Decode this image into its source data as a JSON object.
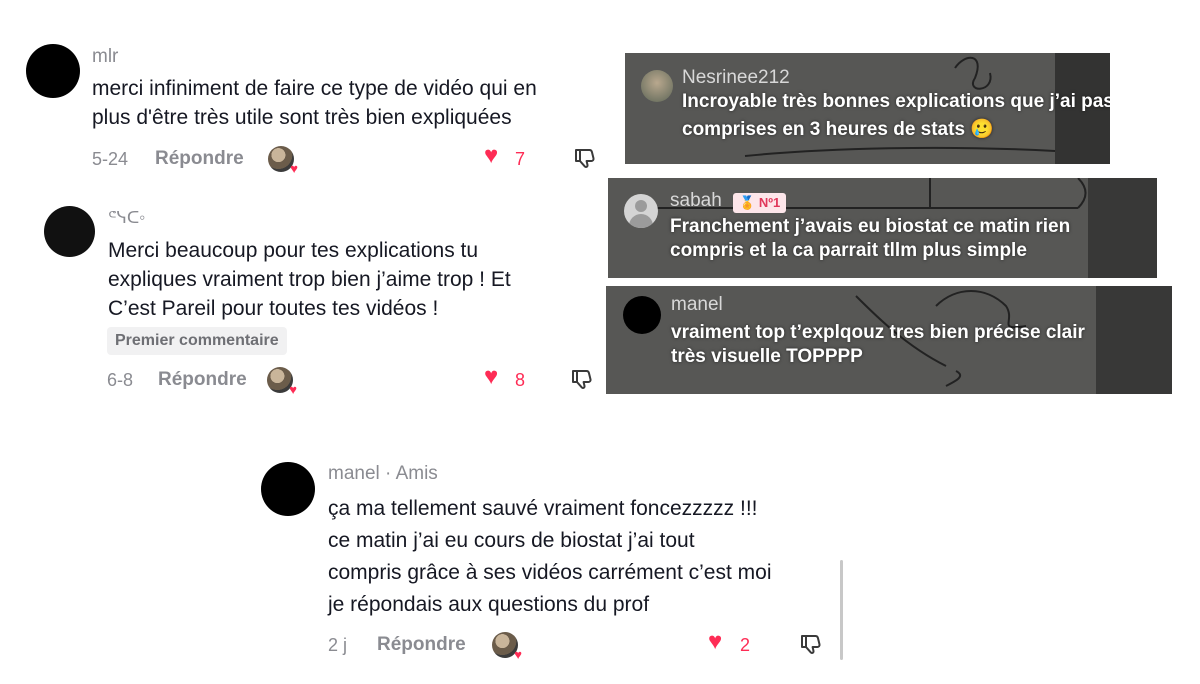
{
  "comments": [
    {
      "username": "mlr",
      "text_lines": [
        "merci infiniment de faire ce type de vidéo qui en",
        "plus d'être très utile sont très bien expliquées"
      ],
      "date": "5-24",
      "reply_label": "Répondre",
      "likes": "7"
    },
    {
      "username": "ᕪᓭᑕ◦",
      "text_lines": [
        "Merci beaucoup pour tes explications tu",
        "expliques vraiment trop bien j’aime trop ! Et",
        "C’est Pareil pour toutes tes vidéos !"
      ],
      "badge": "Premier commentaire",
      "date": "6-8",
      "reply_label": "Répondre",
      "likes": "8"
    },
    {
      "username": "manel",
      "relation": "· Amis",
      "text_lines": [
        "ça ma tellement sauvé vraiment foncezzzzz !!!",
        "ce matin j’ai eu cours de biostat j’ai tout",
        "compris grâce à ses vidéos carrément c’est moi",
        "je répondais aux questions du prof"
      ],
      "date": "2 j",
      "reply_label": "Répondre",
      "likes": "2"
    }
  ],
  "overlays": [
    {
      "username": "Nesrinee212",
      "text_lines": [
        "Incroyable très bonnes explications que j’ai pas",
        "comprises en 3 heures de stats 🥲"
      ]
    },
    {
      "username": "sabah",
      "rank": "Nº1",
      "text_lines": [
        "Franchement j’avais eu biostat ce matin rien",
        "compris et la ca parrait tllm plus simple"
      ]
    },
    {
      "username": "manel",
      "text_lines": [
        "vraiment top t’explqouz tres bien précise clair",
        "très visuelle TOPPPP"
      ]
    }
  ],
  "icons": {
    "heart": "heart-icon",
    "dislike": "thumbs-down-icon",
    "creator_liked": "creator-liked-avatar-icon"
  },
  "colors": {
    "like_red": "#fe2c55",
    "muted_text": "#8a8b91",
    "body_text": "#161823"
  }
}
